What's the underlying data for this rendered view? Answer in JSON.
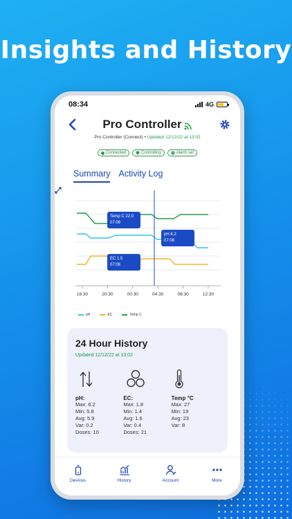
{
  "headline": "Insights and History",
  "status": {
    "time": "08:34",
    "network": "4G"
  },
  "header": {
    "title": "Pro Controller",
    "subtitle_prefix": "Pro Controller (Connect)",
    "subtitle_sep": "•",
    "subtitle_updated": "Updated 12/12/22 at 13:02"
  },
  "badges": [
    "Connected",
    "Controlling",
    "Alarm set"
  ],
  "tabs": [
    "Summary",
    "Activity Log"
  ],
  "chart_data": {
    "type": "line",
    "x": [
      "16:30",
      "20:30",
      "00:30",
      "04:30",
      "08:30",
      "12:30"
    ],
    "series": [
      {
        "name": "pH",
        "color": "#2ec6e0"
      },
      {
        "name": "EC",
        "color": "#f0b429"
      },
      {
        "name": "Temp C",
        "color": "#1f9d4a"
      }
    ],
    "tooltips": [
      {
        "label": "Temp C 22.0",
        "time": "07:08"
      },
      {
        "label": "pH 6.2",
        "time": "07:08"
      },
      {
        "label": "EC 1.5",
        "time": "07:08"
      }
    ],
    "legend_position": "bottom-left"
  },
  "history": {
    "title": "24 Hour History",
    "updated": "Updated 12/12/22 at 13:02",
    "metrics": [
      {
        "name": "pH:",
        "icon": "arrows-up-down-icon",
        "stats": [
          "Max: 6.2",
          "Min: 5.8",
          "Avg: 5.9",
          "Var: 0.2",
          "Doses: 10"
        ]
      },
      {
        "name": "EC:",
        "icon": "molecule-icon",
        "stats": [
          "Max: 1.8",
          "Min: 1.4",
          "Avg: 1.6",
          "Var: 0.4",
          "Doses: 21"
        ]
      },
      {
        "name": "Temp °C",
        "icon": "thermometer-icon",
        "stats": [
          "Max: 27",
          "Min: 19",
          "Avg: 23",
          "Var: 8"
        ]
      }
    ]
  },
  "tabbar": [
    "Devices",
    "History",
    "Account",
    "More"
  ],
  "colors": {
    "accent": "#1b45b8",
    "green": "#1f9d4a",
    "tooltip": "#1b4bc4"
  }
}
